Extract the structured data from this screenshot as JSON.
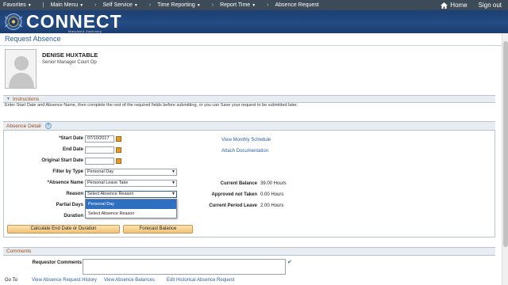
{
  "topnav": {
    "favorites": "Favorites",
    "main_menu": "Main Menu",
    "crumbs": [
      "Self Service",
      "Time Reporting",
      "Report Time",
      "Absence Request"
    ],
    "home": "Home",
    "sign_out": "Sign out"
  },
  "banner": {
    "brand": "CONNECT",
    "subtitle": "Maryland Judiciary"
  },
  "page": {
    "title": "Request Absence"
  },
  "employee": {
    "name": "DENISE HUXTABLE",
    "title": "Senior Manager Court Op"
  },
  "instructions": {
    "header": "Instructions",
    "text": "Enter Start Date and Absence Name, then complete the rest of the required fields before submitting, or you can Save your request to be submitted later."
  },
  "absence_detail": {
    "header": "Absence Detail",
    "help": "?",
    "start_date_label": "*Start Date",
    "start_date_value": "07/10/2017",
    "end_date_label": "End Date",
    "original_start_label": "Original Start Date",
    "filter_label": "Filter by Type",
    "filter_value": "Personal Day",
    "absence_name_label": "*Absence Name",
    "absence_name_value": "Personal Leave Take",
    "reason_label": "Reason",
    "reason_value": "Select Absence Reason",
    "reason_options": [
      "Personal Day",
      "Select Absence Reason"
    ],
    "partial_days_label": "Partial Days",
    "duration_label": "Duration",
    "duration_unit": "Hours",
    "view_schedule": "View Monthly Schedule",
    "attach_doc": "Attach Documentation",
    "current_balance_label": "Current Balance",
    "current_balance_value": "39.00 Hours",
    "approved_label": "Approved not Taken",
    "approved_value": "0.00 Hours",
    "period_label": "Current Period Leave",
    "period_value": "2.00 Hours",
    "calc_button": "Calculate End Date or Duration",
    "forecast_button": "Forecast Balance"
  },
  "comments": {
    "header": "Comments",
    "requestor_label": "Requestor Comments"
  },
  "footer": {
    "goto": "Go To",
    "links": [
      "View Absence Request History",
      "View Absence Balances",
      "Edit Historical Absence Request"
    ]
  },
  "colors": {
    "nav_bg": "#3d4a57",
    "banner": "#234b84",
    "link": "#2e5fa0",
    "section_text": "#a24a11",
    "selected_option": "#2f6fc1"
  }
}
